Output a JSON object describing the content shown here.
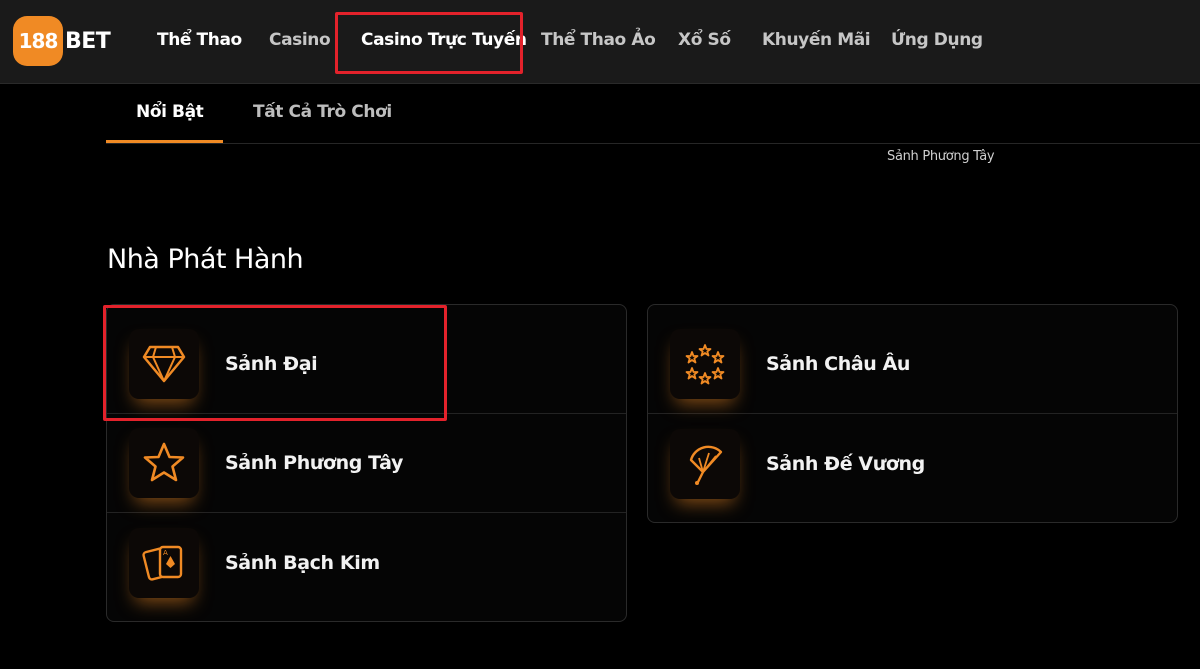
{
  "brand": {
    "logo_number": "188",
    "logo_text": "BET",
    "accent_color": "#f08a24",
    "highlight_color": "#e3222b"
  },
  "nav": {
    "items": [
      {
        "label": "Thể Thao"
      },
      {
        "label": "Casino"
      },
      {
        "label": "Casino Trực Tuyến"
      },
      {
        "label": "Thể Thao Ảo"
      },
      {
        "label": "Xổ Số"
      },
      {
        "label": "Khuyến Mãi"
      },
      {
        "label": "Ứng Dụng"
      }
    ]
  },
  "subtabs": {
    "items": [
      {
        "label": "Nổi Bật"
      },
      {
        "label": "Tất Cả Trò Chơi"
      }
    ]
  },
  "hint": "Sảnh Phương Tây",
  "section": {
    "title": "Nhà Phát Hành"
  },
  "providers_left": [
    {
      "label": "Sảnh Đại",
      "icon": "diamond-icon"
    },
    {
      "label": "Sảnh Phương Tây",
      "icon": "star-icon"
    },
    {
      "label": "Sảnh Bạch Kim",
      "icon": "playing-cards-icon"
    }
  ],
  "providers_right": [
    {
      "label": "Sảnh Châu Âu",
      "icon": "star-circle-icon"
    },
    {
      "label": "Sảnh Đế Vương",
      "icon": "fan-icon"
    }
  ]
}
